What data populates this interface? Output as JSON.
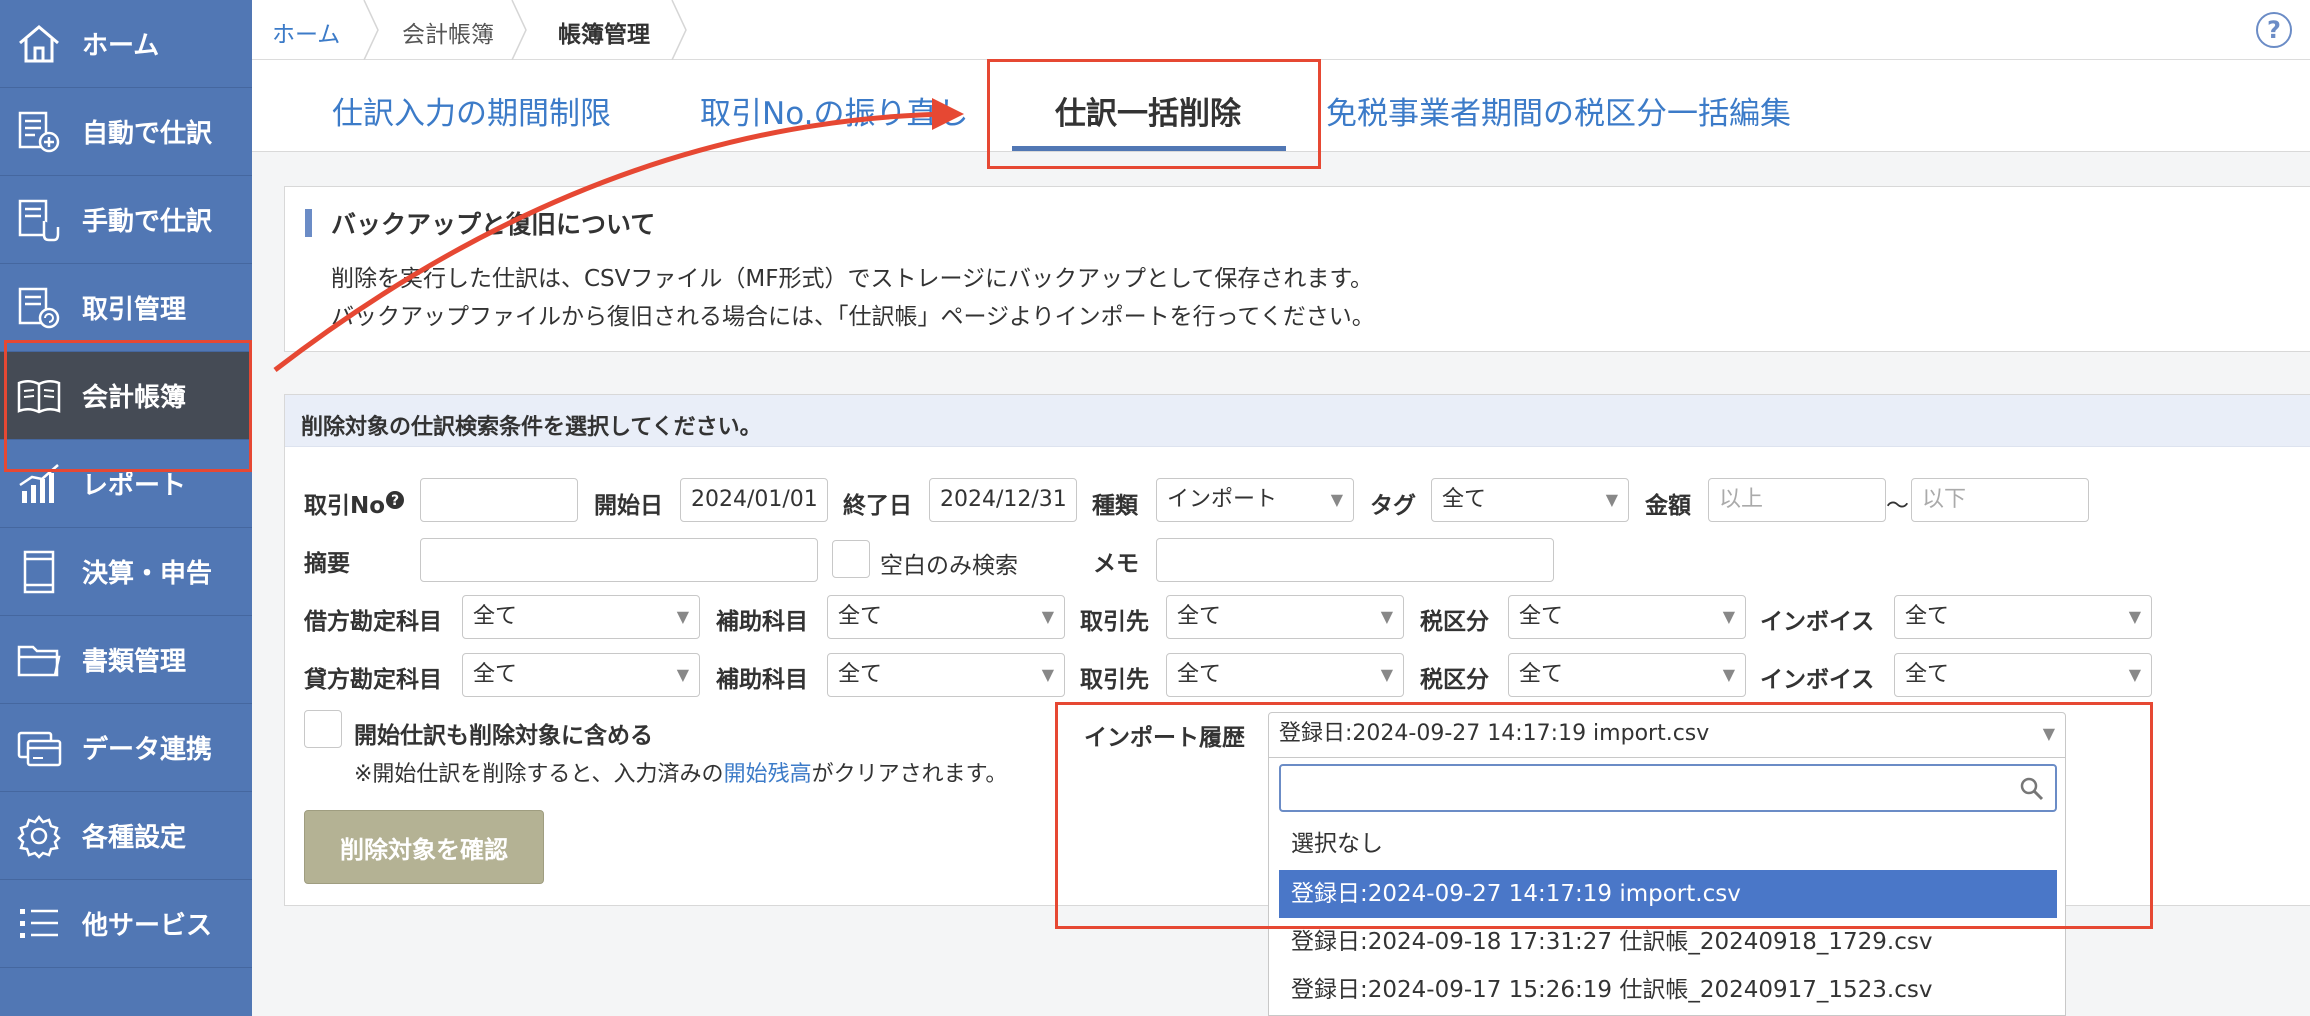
{
  "sidebar": {
    "items": [
      {
        "label": "ホーム",
        "icon": "home-icon"
      },
      {
        "label": "自動で仕訳",
        "icon": "auto-entry-icon"
      },
      {
        "label": "手動で仕訳",
        "icon": "manual-entry-icon"
      },
      {
        "label": "取引管理",
        "icon": "transaction-icon"
      },
      {
        "label": "会計帳簿",
        "icon": "ledger-book-icon"
      },
      {
        "label": "レポート",
        "icon": "report-chart-icon"
      },
      {
        "label": "決算・申告",
        "icon": "tax-filing-icon"
      },
      {
        "label": "書類管理",
        "icon": "folder-icon"
      },
      {
        "label": "データ連携",
        "icon": "data-link-icon"
      },
      {
        "label": "各種設定",
        "icon": "gear-icon"
      },
      {
        "label": "他サービス",
        "icon": "list-icon"
      }
    ]
  },
  "breadcrumb": [
    "ホーム",
    "会計帳簿",
    "帳簿管理"
  ],
  "tabs": [
    "仕訳入力の期間制限",
    "取引No.の振り直し",
    "仕訳一括削除",
    "免税事業者期間の税区分一括編集"
  ],
  "info": {
    "title": "バックアップと復旧について",
    "line1": "削除を実行した仕訳は、CSVファイル（MF形式）でストレージにバックアップとして保存されます。",
    "line2": "バックアップファイルから復旧される場合には、「仕訳帳」ページよりインポートを行ってください。"
  },
  "search": {
    "title": "削除対象の仕訳検索条件を選択してください。",
    "labels": {
      "txn_no": "取引No",
      "start_date": "開始日",
      "end_date": "終了日",
      "kind": "種類",
      "tag": "タグ",
      "amount": "金額",
      "tilde": "〜",
      "summary": "摘要",
      "blank_only": "空白のみ検索",
      "memo": "メモ",
      "debit_account": "借方勘定科目",
      "credit_account": "貸方勘定科目",
      "sub_account": "補助科目",
      "partner": "取引先",
      "tax_class": "税区分",
      "invoice": "インボイス",
      "include_opening": "開始仕訳も削除対象に含める",
      "import_history": "インポート履歴"
    },
    "values": {
      "start_date": "2024/01/01",
      "end_date": "2024/12/31",
      "kind": "インポート",
      "all": "全て",
      "import_selected": "登録日:2024-09-27 14:17:19 import.csv"
    },
    "placeholders": {
      "amount_min": "以上",
      "amount_max": "以下"
    },
    "note_prefix": "※開始仕訳を削除すると、入力済みの",
    "note_link": "開始残高",
    "note_suffix": "がクリアされます。",
    "confirm_button": "削除対象を確認"
  },
  "dropdown": {
    "options": [
      "選択なし",
      "登録日:2024-09-27 14:17:19 import.csv",
      "登録日:2024-09-18 17:31:27 仕訳帳_20240918_1729.csv",
      "登録日:2024-09-17 15:26:19 仕訳帳_20240917_1523.csv"
    ],
    "selected_index": 1
  },
  "colors": {
    "sidebar": "#5177b4",
    "sidebar_active": "#454b55",
    "link": "#3c7bc8",
    "annotation": "#e64833",
    "dropdown_selected": "#4a77c8"
  }
}
